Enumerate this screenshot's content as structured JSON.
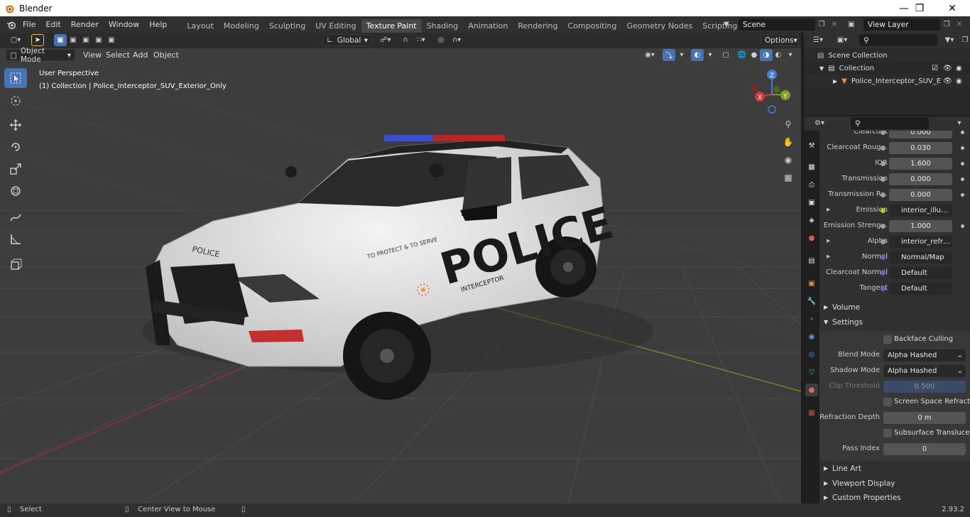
{
  "window": {
    "title": "Blender",
    "controls": [
      "—",
      "❐",
      "✕"
    ]
  },
  "menu": [
    "File",
    "Edit",
    "Render",
    "Window",
    "Help"
  ],
  "workspaces": [
    {
      "label": "Layout",
      "active": false
    },
    {
      "label": "Modeling",
      "active": false
    },
    {
      "label": "Sculpting",
      "active": false
    },
    {
      "label": "UV Editing",
      "active": false
    },
    {
      "label": "Texture Paint",
      "active": true
    },
    {
      "label": "Shading",
      "active": false
    },
    {
      "label": "Animation",
      "active": false
    },
    {
      "label": "Rendering",
      "active": false
    },
    {
      "label": "Compositing",
      "active": false
    },
    {
      "label": "Geometry Nodes",
      "active": false
    },
    {
      "label": "Scripting",
      "active": false
    }
  ],
  "add_workspace": "+",
  "scene": {
    "name": "Scene",
    "view_layer": "View Layer"
  },
  "viewport": {
    "mode": "Object Mode",
    "menus": [
      "View",
      "Select",
      "Add",
      "Object"
    ],
    "orientation": "Global",
    "options_label": "Options",
    "perspective": "User Perspective",
    "collection_info": "(1) Collection | Police_Interceptor_SUV_Exterior_Only",
    "gizmo_axes": {
      "x": "X",
      "y": "Y",
      "z": "Z"
    },
    "car_texts": {
      "hood": "POLICE",
      "side": "POLICE",
      "slogan": "TO PROTECT & TO SERVE",
      "sub": "INTERCEPTOR"
    }
  },
  "outliner": {
    "search_placeholder": "",
    "rows": [
      {
        "label": "Scene Collection",
        "indent": 0
      },
      {
        "label": "Collection",
        "indent": 1
      },
      {
        "label": "Police_Interceptor_SUV_E",
        "indent": 2
      }
    ]
  },
  "properties": {
    "search_placeholder": "",
    "rows": [
      {
        "label": "Clearcoat",
        "value": "0.000",
        "kind": "num",
        "socket": "#a1a1a1"
      },
      {
        "label": "Clearcoat Roug...",
        "value": "0.030",
        "kind": "num",
        "socket": "#a1a1a1"
      },
      {
        "label": "IOR",
        "value": "1.600",
        "kind": "num",
        "socket": "#a1a1a1"
      },
      {
        "label": "Transmission",
        "value": "0.000",
        "kind": "num",
        "socket": "#a1a1a1"
      },
      {
        "label": "Transmission R...",
        "value": "0.000",
        "kind": "num",
        "socket": "#a1a1a1"
      },
      {
        "label": "Emission",
        "value": "interior_illumination...",
        "kind": "link",
        "socket": "#c7c729"
      },
      {
        "label": "Emission Streng...",
        "value": "1.000",
        "kind": "num",
        "socket": "#a1a1a1"
      },
      {
        "label": "Alpha",
        "value": "interior_refraction_in...",
        "kind": "link",
        "socket": "#a1a1a1"
      },
      {
        "label": "Normal",
        "value": "Normal/Map",
        "kind": "link",
        "socket": "#6363c7"
      },
      {
        "label": "Clearcoat Normal",
        "value": "Default",
        "kind": "link",
        "socket": "#6363c7"
      },
      {
        "label": "Tangent",
        "value": "Default",
        "kind": "link",
        "socket": "#6363c7"
      }
    ],
    "panels": {
      "volume": "Volume",
      "settings": "Settings",
      "line_art": "Line Art",
      "viewport_display": "Viewport Display",
      "custom_properties": "Custom Properties"
    },
    "settings": {
      "backface_culling": "Backface Culling",
      "blend_mode_label": "Blend Mode",
      "blend_mode": "Alpha Hashed",
      "shadow_mode_label": "Shadow Mode",
      "shadow_mode": "Alpha Hashed",
      "clip_threshold_label": "Clip Threshold",
      "clip_threshold": "0.500",
      "ssr": "Screen Space Refraction",
      "refraction_depth_label": "Refraction Depth",
      "refraction_depth": "0 m",
      "subsurface": "Subsurface Translucency",
      "pass_index_label": "Pass Index",
      "pass_index": "0"
    }
  },
  "status": {
    "select": "Select",
    "center": "Center View to Mouse",
    "version": "2.93.2"
  },
  "colors": {
    "accent": "#4772b3",
    "bg": "#1d1d1d",
    "panel": "#303030",
    "header": "#2b2b2b",
    "x_axis": "#c83c3c",
    "y_axis": "#7ea02a",
    "z_axis": "#3f7fd6"
  }
}
